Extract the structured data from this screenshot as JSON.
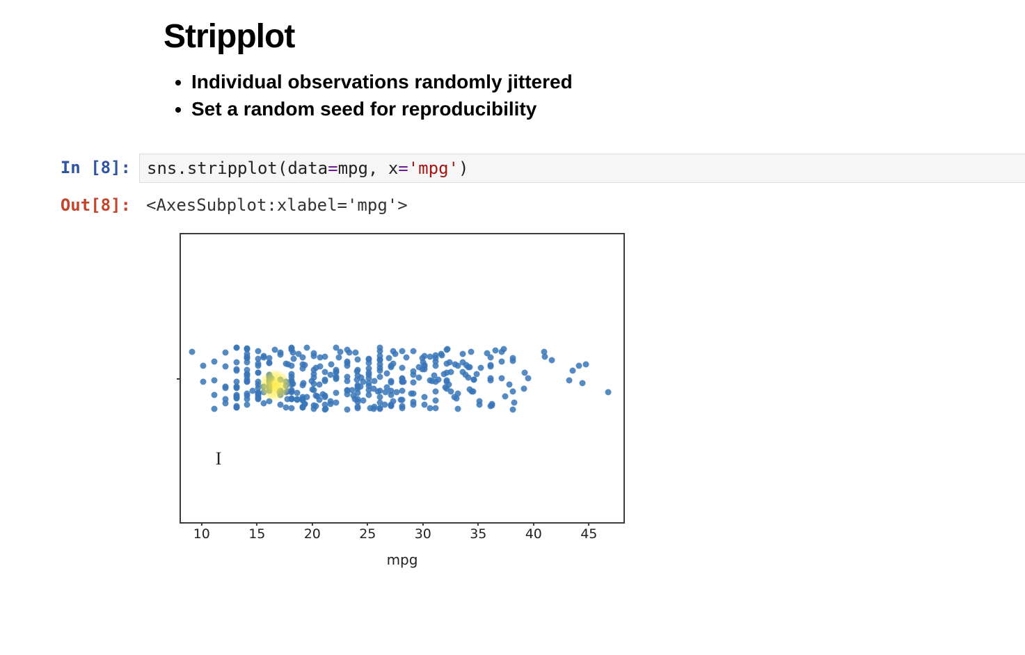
{
  "heading": "Stripplot",
  "bullets": [
    "Individual observations randomly jittered",
    "Set a random seed for reproducibility"
  ],
  "cell": {
    "exec_count": 8,
    "in_label": "In [8]:",
    "out_label": "Out[8]:",
    "code": {
      "obj": "sns",
      "dot": ".",
      "fn": "stripplot",
      "open": "(",
      "p1": "data",
      "eq": "=",
      "v1": "mpg",
      "comma": ", ",
      "p2": "x",
      "v2": "'mpg'",
      "close": ")"
    },
    "output_text": "<AxesSubplot:xlabel='mpg'>"
  },
  "chart_data": {
    "type": "scatter",
    "style": "stripplot",
    "title": "",
    "xlabel": "mpg",
    "ylabel": "",
    "xlim": [
      8,
      48
    ],
    "xticks": [
      10,
      15,
      20,
      25,
      30,
      35,
      40,
      45
    ],
    "jitter_y_range": [
      -0.1,
      0.1
    ],
    "x": [
      18,
      15,
      18,
      16,
      17,
      15,
      14,
      14,
      14,
      15,
      15,
      14,
      15,
      14,
      24,
      22,
      18,
      21,
      27,
      26,
      25,
      24,
      25,
      26,
      21,
      10,
      10,
      11,
      9,
      27,
      28,
      25,
      25,
      19,
      16,
      17,
      19,
      18,
      14,
      14,
      14,
      14,
      12,
      13,
      13,
      18,
      22,
      19,
      18,
      23,
      28,
      30,
      30,
      31,
      35,
      27,
      26,
      24,
      25,
      23,
      20,
      21,
      13,
      14,
      15,
      14,
      17,
      11,
      13,
      12,
      13,
      19,
      15,
      13,
      13,
      14,
      18,
      22,
      21,
      26,
      22,
      28,
      23,
      28,
      27,
      13,
      14,
      13,
      14,
      15,
      12,
      13,
      13,
      14,
      13,
      12,
      13,
      18,
      16,
      18,
      18,
      23,
      26,
      11,
      12,
      13,
      12,
      18,
      20,
      21,
      22,
      18,
      19,
      21,
      26,
      15,
      16,
      29,
      24,
      20,
      19,
      15,
      24,
      20,
      11,
      20,
      21,
      19,
      15,
      31,
      26,
      32,
      25,
      16,
      16,
      18,
      16,
      13,
      14,
      14,
      14,
      29,
      26,
      26,
      31,
      32,
      28,
      24,
      26,
      24,
      26,
      31,
      19,
      18,
      15,
      15,
      16,
      15,
      16,
      14,
      17,
      16,
      15,
      18,
      21,
      20,
      13,
      29,
      23,
      20,
      23,
      24,
      25,
      24,
      18,
      29,
      19,
      23,
      23,
      22,
      25,
      33,
      28,
      25,
      25,
      26,
      27,
      17.5,
      16,
      15.5,
      14.5,
      22,
      24,
      24.5,
      29,
      33,
      20,
      18,
      18.5,
      17.5,
      29.5,
      32,
      28,
      26.5,
      20,
      13,
      19,
      19,
      31,
      30.5,
      36,
      25.5,
      33.5,
      17.5,
      17,
      15.5,
      15,
      17.5,
      20.5,
      19,
      18.5,
      16,
      15.5,
      15.5,
      16,
      29,
      24.5,
      26,
      25.5,
      30.5,
      33.5,
      30,
      30.5,
      22,
      21.5,
      21.5,
      43.1,
      36.1,
      32.8,
      39.4,
      36.1,
      19.9,
      19.4,
      20.2,
      19.2,
      25.1,
      20.5,
      19.4,
      20.6,
      20.8,
      18.6,
      18.1,
      19.2,
      17.7,
      18.1,
      17.5,
      30,
      27.5,
      27.2,
      30.9,
      21.1,
      23.2,
      23.8,
      23.9,
      20.3,
      17,
      21.6,
      16.2,
      31.5,
      29.5,
      21.5,
      19.8,
      22.3,
      20.2,
      20.6,
      17,
      17.6,
      16.5,
      18.2,
      16.9,
      15.5,
      19.2,
      18.5,
      31.9,
      34.1,
      35.7,
      27.4,
      25.4,
      23,
      27.2,
      23.9,
      34.2,
      34.5,
      31.8,
      37.3,
      28.4,
      28.8,
      26.8,
      33.5,
      41.5,
      38.1,
      32.1,
      37.2,
      28,
      26.4,
      24.3,
      19.1,
      34.3,
      29.8,
      31.3,
      37,
      32.2,
      46.6,
      27.9,
      40.8,
      44.3,
      43.4,
      36.4,
      30,
      44.6,
      40.9,
      33.8,
      29.8,
      32.7,
      23.7,
      35,
      23.6,
      32.4,
      27.2,
      26.6,
      25.8,
      23.5,
      30,
      39.1,
      39,
      35.1,
      32.3,
      37,
      37.7,
      34.1,
      34.7,
      34.4,
      29.9,
      33,
      34.5,
      33.7,
      32.4,
      32.9,
      31.6,
      28.1,
      30.7,
      25.4,
      24.2,
      22.4,
      26.6,
      20.2,
      17.6,
      28,
      27,
      34,
      31,
      29,
      27,
      24,
      23,
      36,
      37,
      31,
      38,
      36,
      36,
      36,
      34,
      38,
      32,
      38,
      25,
      38,
      26,
      22,
      32,
      36,
      27,
      27,
      44,
      32,
      28,
      31
    ],
    "highlight_x": 16.5,
    "cursor_at_x": 11.4,
    "cursor_glyph": "I"
  }
}
